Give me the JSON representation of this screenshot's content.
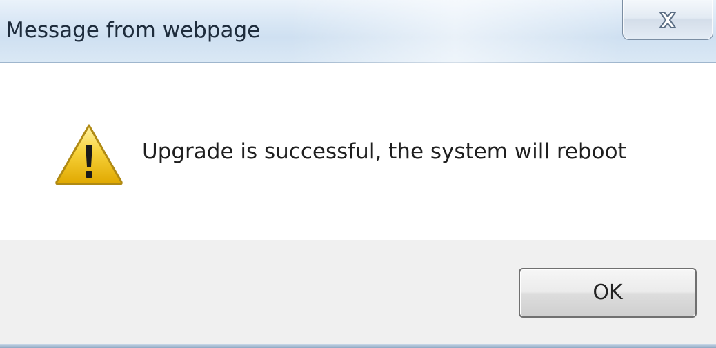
{
  "window": {
    "title": "Message from webpage"
  },
  "message": {
    "text": "Upgrade is successful, the system will reboot",
    "icon": "warning-icon"
  },
  "buttons": {
    "ok_label": "OK",
    "close_icon": "close-icon"
  },
  "colors": {
    "titlebar": "#d9e7f5",
    "footer": "#f0f0f0",
    "warning": "#f2c40f"
  }
}
